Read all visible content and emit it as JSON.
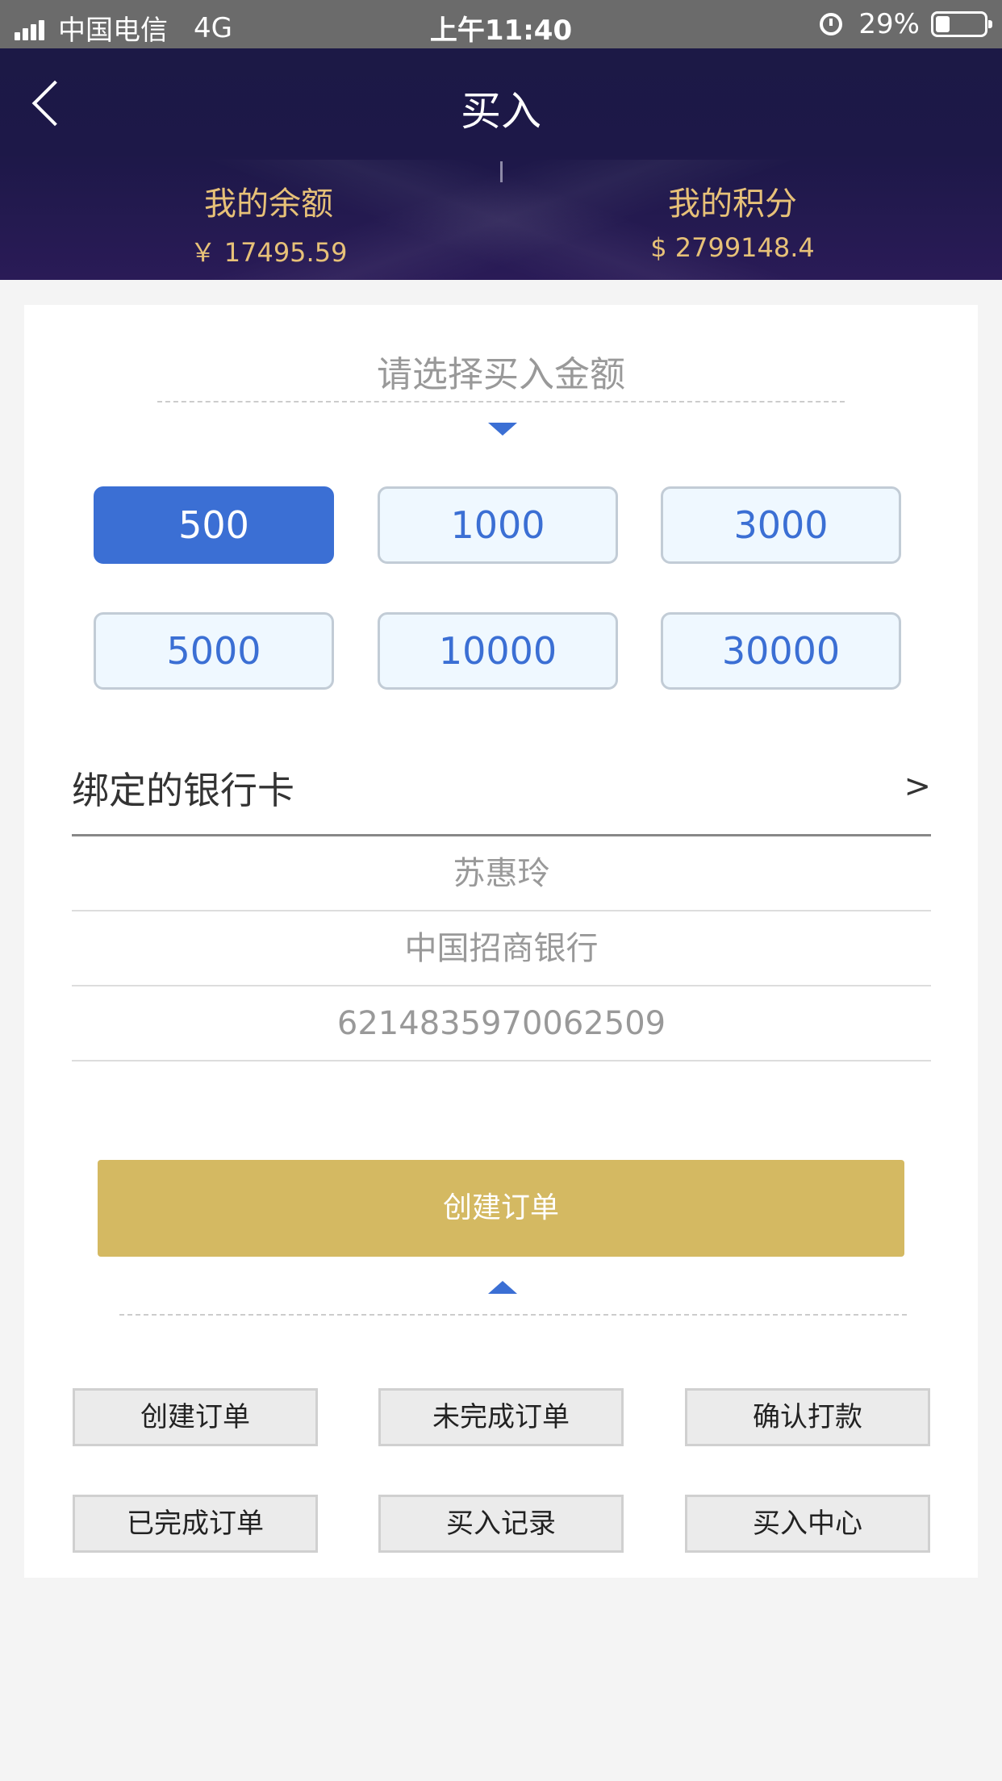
{
  "status_bar": {
    "carrier": "中国电信",
    "network": "4G",
    "time": "上午11:40",
    "battery": "29%",
    "battery_level": 0.29,
    "icons": [
      "signal-icon",
      "alarm-icon",
      "battery-icon"
    ]
  },
  "nav": {
    "title": "买入",
    "back_icon": "chevron-left-icon"
  },
  "summary": {
    "balance_label": "我的余额",
    "balance_value": "￥ 17495.59",
    "points_label": "我的积分",
    "points_value": "$ 2799148.4"
  },
  "amount": {
    "prompt": "请选择买入金额",
    "options": [
      "500",
      "1000",
      "3000",
      "5000",
      "10000",
      "30000"
    ],
    "selected": "500"
  },
  "bank": {
    "title": "绑定的银行卡",
    "arrow": ">",
    "name": "苏惠玲",
    "bank_name": "中国招商银行",
    "card_number": "6214835970062509"
  },
  "create_order_label": "创建订单",
  "functions": [
    "创建订单",
    "未完成订单",
    "确认打款",
    "已完成订单",
    "买入记录",
    "买入中心"
  ],
  "colors": {
    "header_bg": "#1c1946",
    "accent_gold": "#e7c178",
    "primary_blue": "#3b6fd4",
    "button_gold": "#d4b962"
  }
}
